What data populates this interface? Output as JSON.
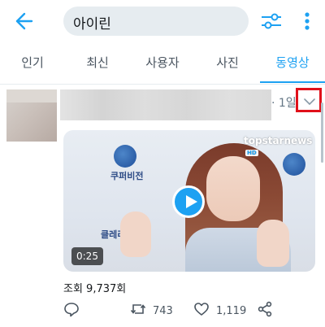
{
  "search": {
    "query": "아이린"
  },
  "tabs": [
    {
      "label": "인기"
    },
    {
      "label": "최신"
    },
    {
      "label": "사용자"
    },
    {
      "label": "사진"
    },
    {
      "label": "동영상"
    }
  ],
  "tweet": {
    "time": "· 1일",
    "video": {
      "brand": "topstarnews",
      "brand_badge": "HD",
      "duration": "0:25",
      "bg_text_1": "쿠퍼비전",
      "bg_text_2": "클레리"
    },
    "views": "조회 9,737회",
    "retweets": "743",
    "likes": "1,119"
  },
  "colors": {
    "accent": "#1da1f2",
    "highlight_box": "#e0101a"
  },
  "icons": [
    "back-arrow-icon",
    "filter-icon",
    "more-vertical-icon",
    "chevron-down-icon",
    "play-icon",
    "reply-icon",
    "retweet-icon",
    "like-icon",
    "share-icon"
  ]
}
